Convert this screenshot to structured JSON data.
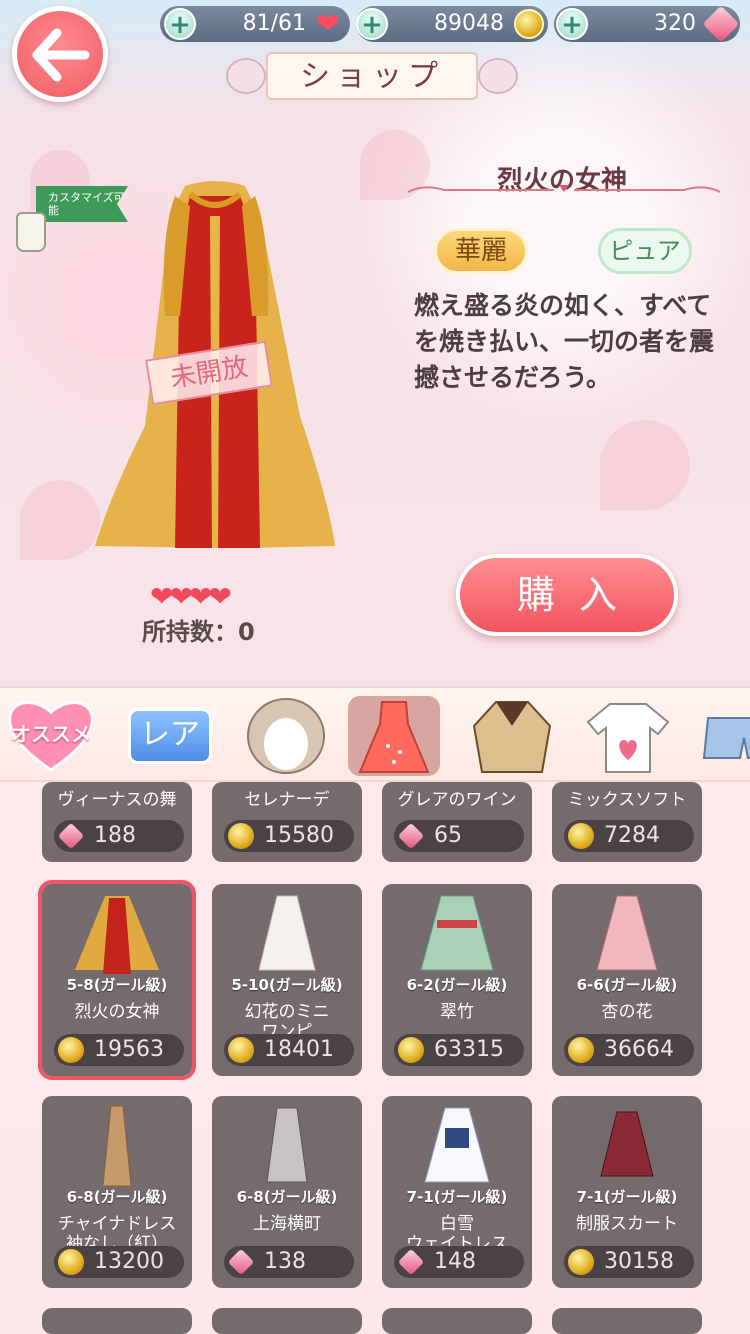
{
  "header": {
    "stamina": "81/61",
    "gold": "89048",
    "diamonds": "320",
    "title": "ショップ"
  },
  "detail": {
    "customize_label": "カスタマイズ可能",
    "locked_label": "未開放",
    "name": "烈火の女神",
    "tags": [
      "華麗",
      "ピュア"
    ],
    "description": "燃え盛る炎の如く、すべてを焼き払い、一切の者を震撼させるだろう。",
    "hearts": "❤❤❤❤",
    "owned": "所持数：0",
    "buy_label": "購入"
  },
  "tabs": {
    "recommended": "オススメ",
    "rare": "レア",
    "items": [
      "hair-icon",
      "dress-icon",
      "coat-icon",
      "top-icon",
      "bottom-icon"
    ],
    "active": "dress-icon"
  },
  "grid": {
    "top_row": [
      {
        "name": "ヴィーナスの舞",
        "currency": "diamond",
        "price": "188"
      },
      {
        "name": "セレナーデ",
        "currency": "gold",
        "price": "15580"
      },
      {
        "name": "グレアのワイン",
        "currency": "diamond",
        "price": "65"
      },
      {
        "name": "ミックスソフト",
        "currency": "gold",
        "price": "7284"
      }
    ],
    "row2": [
      {
        "stage": "5-8(ガール級)",
        "name": "烈火の女神",
        "currency": "gold",
        "price": "19563",
        "selected": true
      },
      {
        "stage": "5-10(ガール級)",
        "name": "幻花のミニ\nワンピ",
        "currency": "gold",
        "price": "18401"
      },
      {
        "stage": "6-2(ガール級)",
        "name": "翠竹",
        "currency": "gold",
        "price": "63315"
      },
      {
        "stage": "6-6(ガール級)",
        "name": "杏の花",
        "currency": "gold",
        "price": "36664"
      }
    ],
    "row3": [
      {
        "stage": "6-8(ガール級)",
        "name": "チャイナドレス\n袖なし（紅）",
        "currency": "gold",
        "price": "13200"
      },
      {
        "stage": "6-8(ガール級)",
        "name": "上海横町",
        "currency": "diamond",
        "price": "138"
      },
      {
        "stage": "7-1(ガール級)",
        "name": "白雪\nウェイトレス",
        "currency": "diamond",
        "price": "148"
      },
      {
        "stage": "7-1(ガール級)",
        "name": "制服スカート",
        "currency": "gold",
        "price": "30158"
      }
    ]
  },
  "colors": {
    "accent": "#f2555e",
    "selected_outline": "#ee5567",
    "cell_bg": "#756a6c"
  }
}
